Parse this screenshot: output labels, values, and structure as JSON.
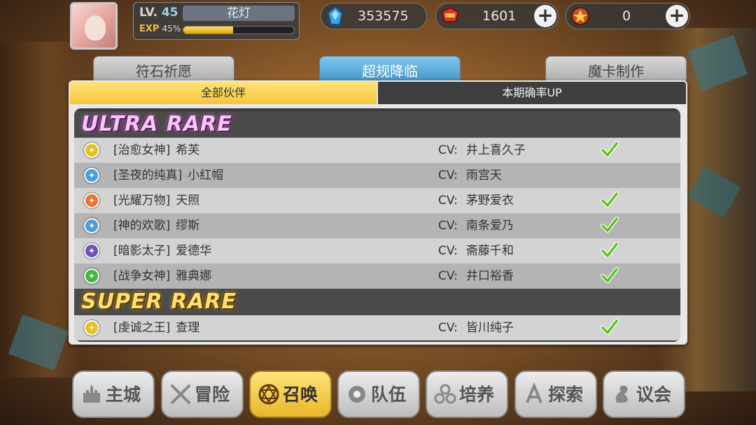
{
  "player": {
    "level_label": "LV.",
    "level": "45",
    "name": "花灯",
    "exp_label": "EXP",
    "exp_percent_text": "45%",
    "exp_fraction": 0.45
  },
  "resources": [
    {
      "icon": "blue-crystal-icon",
      "value": "353575",
      "has_plus": false
    },
    {
      "icon": "red-gem-icon",
      "value": "1601",
      "has_plus": true
    },
    {
      "icon": "summon-ticket-icon",
      "value": "0",
      "has_plus": true
    }
  ],
  "tabs": [
    "符石祈愿",
    "超规降临",
    "魔卡制作"
  ],
  "active_tab": 1,
  "subtabs": {
    "all": "全部伙伴",
    "up": "本期确率UP"
  },
  "rarity_groups": [
    {
      "label": "ULTRA RARE",
      "rows": [
        {
          "title": "[治愈女神]",
          "name": "希芙",
          "cv_label": "CV:",
          "cv": "井上喜久子",
          "checked": true,
          "element": "light",
          "color": "#e8c020"
        },
        {
          "title": "[圣夜的纯真]",
          "name": "小红帽",
          "cv_label": "CV:",
          "cv": "雨宫天",
          "checked": false,
          "element": "water",
          "color": "#4a9ee0"
        },
        {
          "title": "[光耀万物]",
          "name": "天照",
          "cv_label": "CV:",
          "cv": "茅野爱衣",
          "checked": true,
          "element": "fire",
          "color": "#f07030"
        },
        {
          "title": "[神的欢歌]",
          "name": "缪斯",
          "cv_label": "CV:",
          "cv": "南条爱乃",
          "checked": true,
          "element": "water",
          "color": "#4a9ee0"
        },
        {
          "title": "[暗影太子]",
          "name": "爱德华",
          "cv_label": "CV:",
          "cv": "斋藤千和",
          "checked": true,
          "element": "dark",
          "color": "#7050c0"
        },
        {
          "title": "[战争女神]",
          "name": "雅典娜",
          "cv_label": "CV:",
          "cv": "井口裕香",
          "checked": true,
          "element": "wind",
          "color": "#40b840"
        }
      ]
    },
    {
      "label": "SUPER RARE",
      "rows": [
        {
          "title": "[虔诚之王]",
          "name": "查理",
          "cv_label": "CV:",
          "cv": "皆川纯子",
          "checked": true,
          "element": "light",
          "color": "#e8c020"
        }
      ]
    }
  ],
  "nav": [
    {
      "icon": "castle-icon",
      "label": "主城",
      "active": false
    },
    {
      "icon": "crossed-swords-icon",
      "label": "冒险",
      "active": false
    },
    {
      "icon": "summon-circle-icon",
      "label": "召唤",
      "active": true
    },
    {
      "icon": "team-icon",
      "label": "队伍",
      "active": false
    },
    {
      "icon": "train-icon",
      "label": "培养",
      "active": false
    },
    {
      "icon": "explore-icon",
      "label": "探索",
      "active": false
    },
    {
      "icon": "council-icon",
      "label": "议会",
      "active": false
    }
  ]
}
